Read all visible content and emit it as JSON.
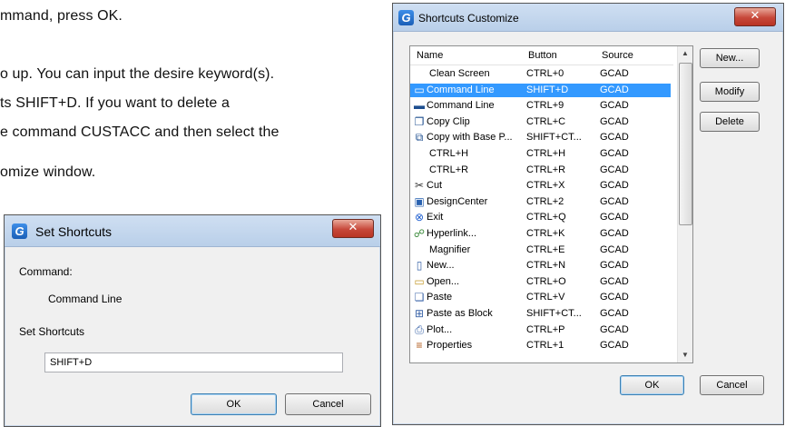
{
  "document": {
    "lines": [
      "mmand, press OK.",
      "o up. You can input the desire keyword(s).",
      "ts SHIFT+D. If you want to delete a",
      "e command CUSTACC and then select the",
      "omize window."
    ]
  },
  "shortcuts_customize": {
    "title": "Shortcuts Customize",
    "close_glyph": "✕",
    "columns": {
      "name": "Name",
      "button": "Button",
      "source": "Source"
    },
    "rows": [
      {
        "name": "Clean Screen",
        "button": "CTRL+0",
        "source": "GCAD",
        "icon": "none",
        "selected": false
      },
      {
        "name": "Command Line",
        "button": "SHIFT+D",
        "source": "GCAD",
        "icon": "command-line-icon",
        "selected": true
      },
      {
        "name": "Command Line",
        "button": "CTRL+9",
        "source": "GCAD",
        "icon": "cmd-icon",
        "selected": false
      },
      {
        "name": "Copy Clip",
        "button": "CTRL+C",
        "source": "GCAD",
        "icon": "copy-clip-icon",
        "selected": false
      },
      {
        "name": "Copy with Base P...",
        "button": "SHIFT+CT...",
        "source": "GCAD",
        "icon": "copy-base-icon",
        "selected": false
      },
      {
        "name": "CTRL+H",
        "button": "CTRL+H",
        "source": "GCAD",
        "icon": "none",
        "selected": false
      },
      {
        "name": "CTRL+R",
        "button": "CTRL+R",
        "source": "GCAD",
        "icon": "none",
        "selected": false
      },
      {
        "name": "Cut",
        "button": "CTRL+X",
        "source": "GCAD",
        "icon": "scissors-icon",
        "selected": false
      },
      {
        "name": "DesignCenter",
        "button": "CTRL+2",
        "source": "GCAD",
        "icon": "design-center-icon",
        "selected": false
      },
      {
        "name": "Exit",
        "button": "CTRL+Q",
        "source": "GCAD",
        "icon": "exit-icon",
        "selected": false
      },
      {
        "name": "Hyperlink...",
        "button": "CTRL+K",
        "source": "GCAD",
        "icon": "hyperlink-icon",
        "selected": false
      },
      {
        "name": "Magnifier",
        "button": "CTRL+E",
        "source": "GCAD",
        "icon": "none",
        "selected": false
      },
      {
        "name": "New...",
        "button": "CTRL+N",
        "source": "GCAD",
        "icon": "new-file-icon",
        "selected": false
      },
      {
        "name": "Open...",
        "button": "CTRL+O",
        "source": "GCAD",
        "icon": "open-folder-icon",
        "selected": false
      },
      {
        "name": "Paste",
        "button": "CTRL+V",
        "source": "GCAD",
        "icon": "paste-icon",
        "selected": false
      },
      {
        "name": "Paste as Block",
        "button": "SHIFT+CT...",
        "source": "GCAD",
        "icon": "paste-block-icon",
        "selected": false
      },
      {
        "name": "Plot...",
        "button": "CTRL+P",
        "source": "GCAD",
        "icon": "printer-icon",
        "selected": false
      },
      {
        "name": "Properties",
        "button": "CTRL+1",
        "source": "GCAD",
        "icon": "properties-icon",
        "selected": false
      }
    ],
    "buttons": {
      "new": "New...",
      "modify": "Modify",
      "delete": "Delete",
      "ok": "OK",
      "cancel": "Cancel"
    }
  },
  "set_shortcuts": {
    "title": "Set Shortcuts",
    "close_glyph": "✕",
    "command_label": "Command:",
    "command_value": "Command Line",
    "shortcut_label": "Set Shortcuts",
    "shortcut_value": "SHIFT+D",
    "buttons": {
      "ok": "OK",
      "cancel": "Cancel"
    }
  },
  "colors": {
    "selection": "#3399ff",
    "titlebar": "#c4d7ee",
    "close": "#c7483a"
  }
}
